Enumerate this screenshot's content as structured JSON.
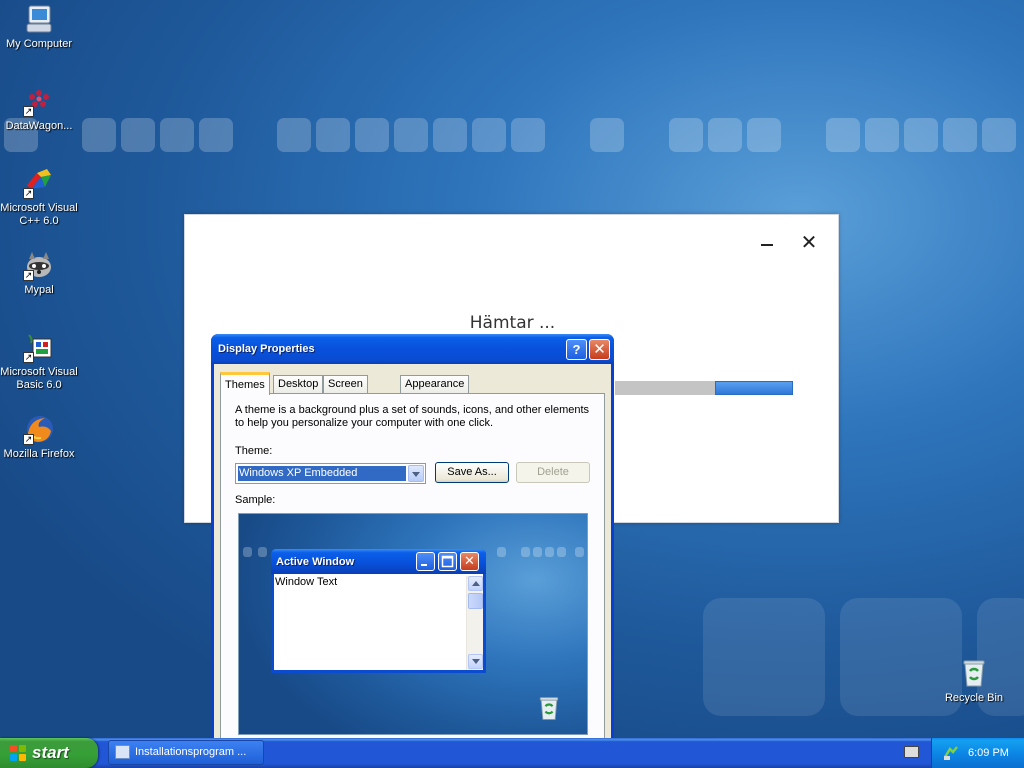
{
  "desktop": {
    "icons": [
      {
        "label": "My Computer",
        "icon": "my-computer-icon"
      },
      {
        "label": "DataWagon...",
        "icon": "datawagon-icon"
      },
      {
        "label": "Microsoft Visual C++ 6.0",
        "icon": "visual-cpp-icon"
      },
      {
        "label": "Mypal",
        "icon": "mypal-icon"
      },
      {
        "label": "Microsoft Visual Basic 6.0",
        "icon": "visual-basic-icon"
      },
      {
        "label": "Mozilla Firefox",
        "icon": "firefox-icon"
      },
      {
        "label": "Recycle Bin",
        "icon": "recycle-bin-icon"
      }
    ]
  },
  "loader": {
    "title": "Hämtar ...",
    "minimize_glyph": "–",
    "close_glyph": "✕",
    "progress": 0.44
  },
  "dialog": {
    "title": "Display Properties",
    "help_glyph": "?",
    "close_glyph": "✕",
    "tabs": [
      "Themes",
      "Desktop",
      "Screen Saver",
      "Appearance"
    ],
    "active_tab": "Themes",
    "description": "A theme is a background plus a set of sounds, icons, and other elements to help you personalize your computer with one click.",
    "theme_label": "Theme:",
    "theme_value": "Windows XP Embedded",
    "save_as_label": "Save As...",
    "delete_label": "Delete",
    "sample_label": "Sample:",
    "sample": {
      "window_title": "Active Window",
      "window_text": "Window Text"
    }
  },
  "taskbar": {
    "start_label": "start",
    "task_label": "Installationsprogram ...",
    "clock": "6:09 PM"
  },
  "colors": {
    "desktop_blue": "#2f76bd",
    "xp_title_blue": "#0851dd",
    "start_green": "#36a036",
    "progress_blue": "#2f78d8"
  }
}
